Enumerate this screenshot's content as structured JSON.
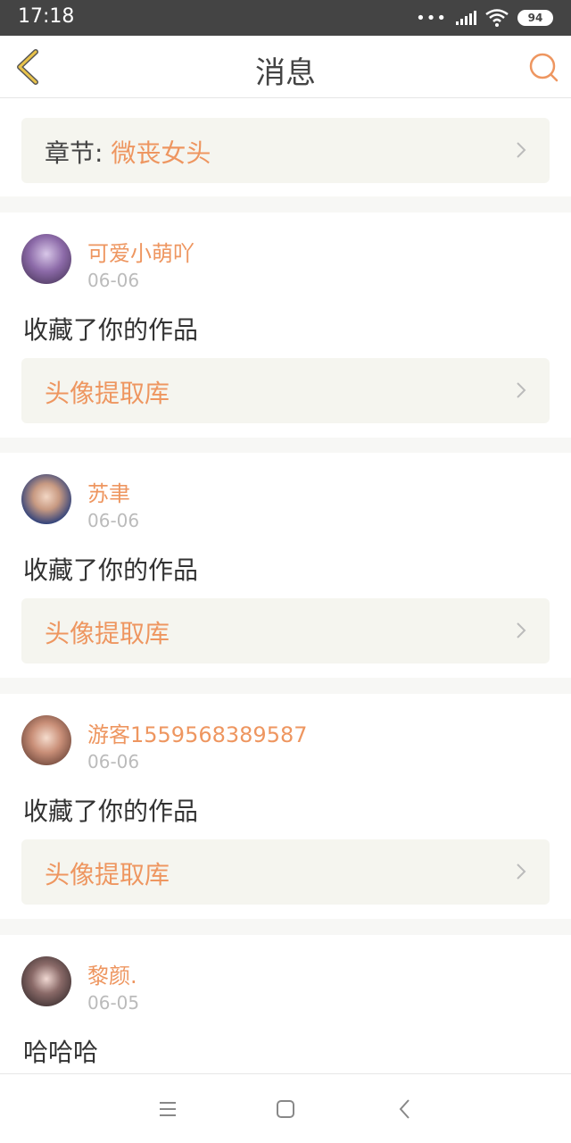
{
  "status_bar": {
    "time": "17:18",
    "dots": "•••",
    "battery": "94"
  },
  "header": {
    "title": "消息"
  },
  "top_card": {
    "chapter_label": "章节:",
    "chapter_name": "微丧女头"
  },
  "messages": [
    {
      "username": "可爱小萌吖",
      "date": "06-06",
      "text": "收藏了你的作品",
      "link": "头像提取库"
    },
    {
      "username": "苏聿",
      "date": "06-06",
      "text": "收藏了你的作品",
      "link": "头像提取库"
    },
    {
      "username": "游客1559568389587",
      "date": "06-06",
      "text": "收藏了你的作品",
      "link": "头像提取库"
    },
    {
      "username": "黎颜.",
      "date": "06-05",
      "text": "哈哈哈"
    }
  ],
  "colors": {
    "accent": "#ee9660",
    "back_arrow": "#e8c24a",
    "status_bar": "#444444",
    "link_box": "#f5f5ef"
  },
  "icons": {
    "back": "chevron-left-icon",
    "search": "search-icon",
    "link_arrow": "chevron-right-icon",
    "nav_menu": "menu-icon",
    "nav_home": "home-square-icon",
    "nav_back": "back-triangle-icon"
  }
}
